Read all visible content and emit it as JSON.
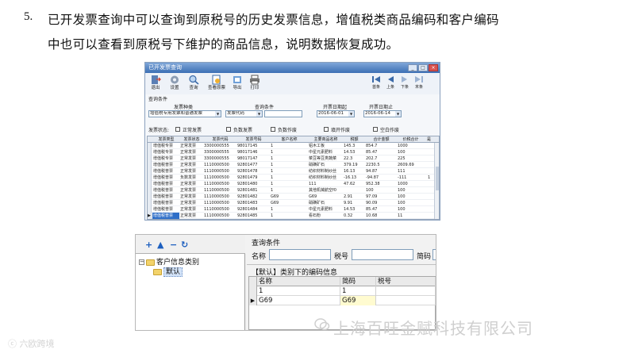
{
  "paragraph": {
    "number": "5.",
    "line1": "已开发票查询中可以查询到原税号的历史发票信息，增值税类商品编码和客户编码",
    "line2": "中也可以查看到原税号下维护的商品信息，说明数据恢复成功。"
  },
  "invoice_window": {
    "title": "已开发票查询",
    "toolbar": [
      {
        "label": "退出",
        "icon": "exit-icon"
      },
      {
        "label": "设置",
        "icon": "gear-icon"
      },
      {
        "label": "查询",
        "icon": "search-icon"
      },
      {
        "label": "查看原票",
        "icon": "view-invoice-icon"
      },
      {
        "label": "导出",
        "icon": "export-icon"
      },
      {
        "label": "打印",
        "icon": "printer-icon"
      }
    ],
    "nav": [
      {
        "label": "首条",
        "icon": "first-icon"
      },
      {
        "label": "上条",
        "icon": "prev-icon"
      },
      {
        "label": "下条",
        "icon": "next-icon"
      },
      {
        "label": "末条",
        "icon": "last-icon"
      }
    ],
    "conditions_title": "查询条件",
    "invoice_type_label": "发票种类",
    "invoice_type_value": "增值税专用发票和普通发票",
    "query_cond_label": "查询条件",
    "query_cond_value": "发票代码",
    "date_start_label": "开票日期起",
    "date_start_value": "2016-06-01",
    "date_end_label": "开票日期止",
    "date_end_value": "2016-06-14",
    "status_label": "发票状态:",
    "status_options": [
      "正常发票",
      "负数发票",
      "负数作废",
      "填开作废",
      "空白作废"
    ],
    "columns": [
      "发票类型",
      "发票状态",
      "发票代码",
      "发票号码",
      "客户名称",
      "主要商品名称",
      "税额",
      "合计金额",
      "价税合计",
      "是"
    ],
    "rows": [
      [
        "增值税专票",
        "正常发票",
        "3300000555",
        "98017145",
        "1",
        "",
        "铝木工板",
        "145.3",
        "854.7",
        "1000"
      ],
      [
        "增值税专票",
        "正常发票",
        "3300000555",
        "98017146",
        "1",
        "",
        "中星元素肥料",
        "14.53",
        "85.47",
        "100"
      ],
      [
        "增值税专票",
        "正常发票",
        "3300000555",
        "98017147",
        "1",
        "",
        "菜豆等豆类蔬菜",
        "22.3",
        "202.7",
        "225"
      ],
      [
        "增值税普票",
        "正常发票",
        "1110000500",
        "92801477",
        "1",
        "",
        "硝磺矿石",
        "379.19",
        "2230.5",
        "2609.69"
      ],
      [
        "增值税普票",
        "正常发票",
        "1110000500",
        "92801478",
        "1",
        "",
        "纺织材料制纱丝",
        "16.13",
        "94.87",
        "111"
      ],
      [
        "增值税普票",
        "负数发票",
        "1110000500",
        "92801479",
        "1",
        "",
        "纺织材料制纱丝",
        "-16.13",
        "-94.87",
        "-111"
      ],
      [
        "增值税普票",
        "正常发票",
        "1110000500",
        "92801480",
        "1",
        "",
        "111",
        "47.62",
        "952.38",
        "1000"
      ],
      [
        "增值税普票",
        "正常发票",
        "1110000500",
        "92801481",
        "1",
        "",
        "其他机械航空f0",
        "",
        "100",
        "100"
      ],
      [
        "增值税普票",
        "正常发票",
        "1110000500",
        "92801482",
        "G69",
        "",
        "G69",
        "2.91",
        "97.09",
        "100"
      ],
      [
        "增值税普票",
        "正常发票",
        "1110000500",
        "92801483",
        "G69",
        "",
        "硝磺矿石",
        "9.91",
        "90.09",
        "100"
      ],
      [
        "增值税普票",
        "正常发票",
        "1110000500",
        "92801484",
        "1",
        "",
        "中星元素肥料",
        "14.53",
        "85.47",
        "100"
      ],
      [
        "增值税普票",
        "正常发票",
        "1110000500",
        "92801485",
        "1",
        "",
        "看石粉",
        "0.32",
        "10.68",
        "11"
      ]
    ],
    "extra_last_col": "1"
  },
  "customer_window": {
    "toolbar_buttons": [
      {
        "label": "+",
        "icon": "add-icon"
      },
      {
        "label": "▲",
        "icon": "up-arrow-icon"
      },
      {
        "label": "−",
        "icon": "remove-icon"
      },
      {
        "label": "↻",
        "icon": "refresh-icon"
      }
    ],
    "tree_root": "客户信息类别",
    "tree_child": "默认",
    "conditions_title": "查询条件",
    "name_label": "名称",
    "tax_label": "税号",
    "code_label": "简码",
    "subtitle": "【默认】类别下的编码信息",
    "columns": [
      "名称",
      "简码",
      "税号"
    ],
    "rows": [
      [
        "1",
        "1",
        ""
      ],
      [
        "G69",
        "G69",
        ""
      ]
    ]
  },
  "watermark": {
    "company": "上海百旺金赋科技有限公司",
    "brand": "六欧跨境"
  },
  "colors": {
    "title_bar": "#3c6fb4",
    "highlight": "#2f6fc8",
    "watermark": "#cfcfcf"
  }
}
